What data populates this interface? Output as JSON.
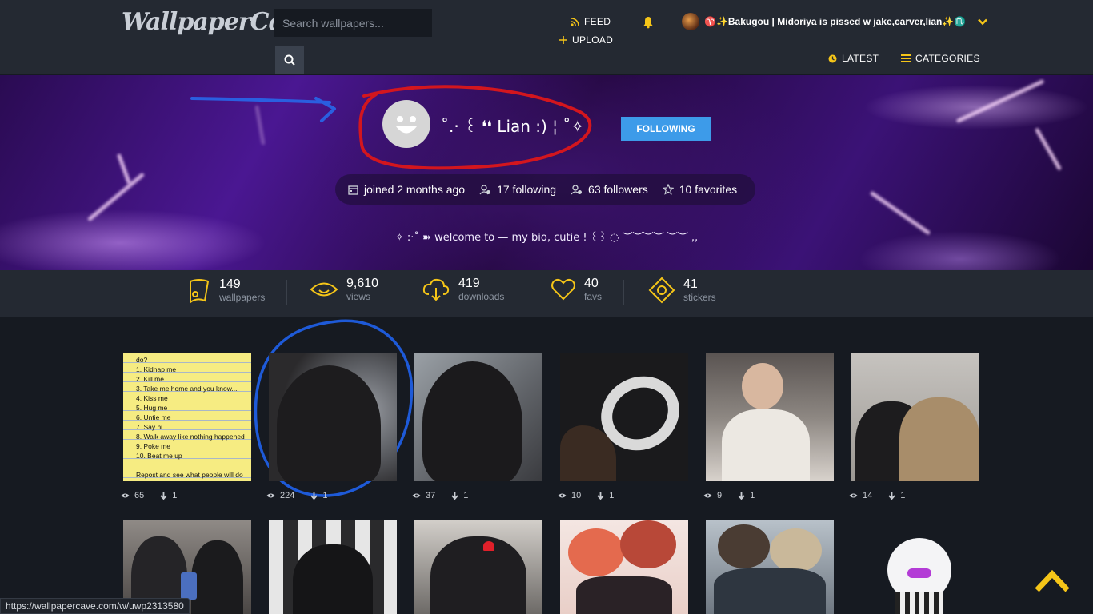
{
  "header": {
    "logo": "WallpaperCave",
    "search_placeholder": "Search wallpapers...",
    "feed": "FEED",
    "upload": "UPLOAD",
    "latest": "LATEST",
    "categories": "CATEGORIES",
    "user_name": "♈✨Bakugou | Midoriya is pissed w jake,carver,lian✨♏"
  },
  "profile": {
    "name": "˚.‧ ꒰ ❛❛ Lian :) ¦ ˚✧",
    "follow_label": "FOLLOWING",
    "joined": "joined 2 months ago",
    "following": "17 following",
    "followers": "63 followers",
    "favorites": "10 favorites",
    "bio": "✧ :·˚ ➽ welcome to — my bio, cutie ! ꒰꒱ ◌ ︶︶︶︶ ︶︶ ,,"
  },
  "stats": [
    {
      "num": "149",
      "label": "wallpapers"
    },
    {
      "num": "9,610",
      "label": "views"
    },
    {
      "num": "419",
      "label": "downloads"
    },
    {
      "num": "40",
      "label": "favs"
    },
    {
      "num": "41",
      "label": "stickers"
    }
  ],
  "note_lines": [
    "do?",
    "1. Kidnap me",
    "2. Kill me",
    "3. Take me home and you know...",
    "4. Kiss me",
    "5. Hug me",
    "6. Untie me",
    "7. Say hi",
    "8. Walk away like nothing happened",
    "9. Poke me",
    "10. Beat me up",
    "Repost and see what people will do"
  ],
  "wallpapers_row1": [
    {
      "views": "65",
      "downloads": "1"
    },
    {
      "views": "224",
      "downloads": "1"
    },
    {
      "views": "37",
      "downloads": "1"
    },
    {
      "views": "10",
      "downloads": "1"
    },
    {
      "views": "9",
      "downloads": "1"
    },
    {
      "views": "14",
      "downloads": "1"
    }
  ],
  "status_url": "https://wallpapercave.com/w/uwp2313580",
  "colors": {
    "accent": "#3d9be9",
    "icon_yellow": "#f5c518",
    "header_bg": "#242932",
    "page_bg": "#161a21"
  }
}
